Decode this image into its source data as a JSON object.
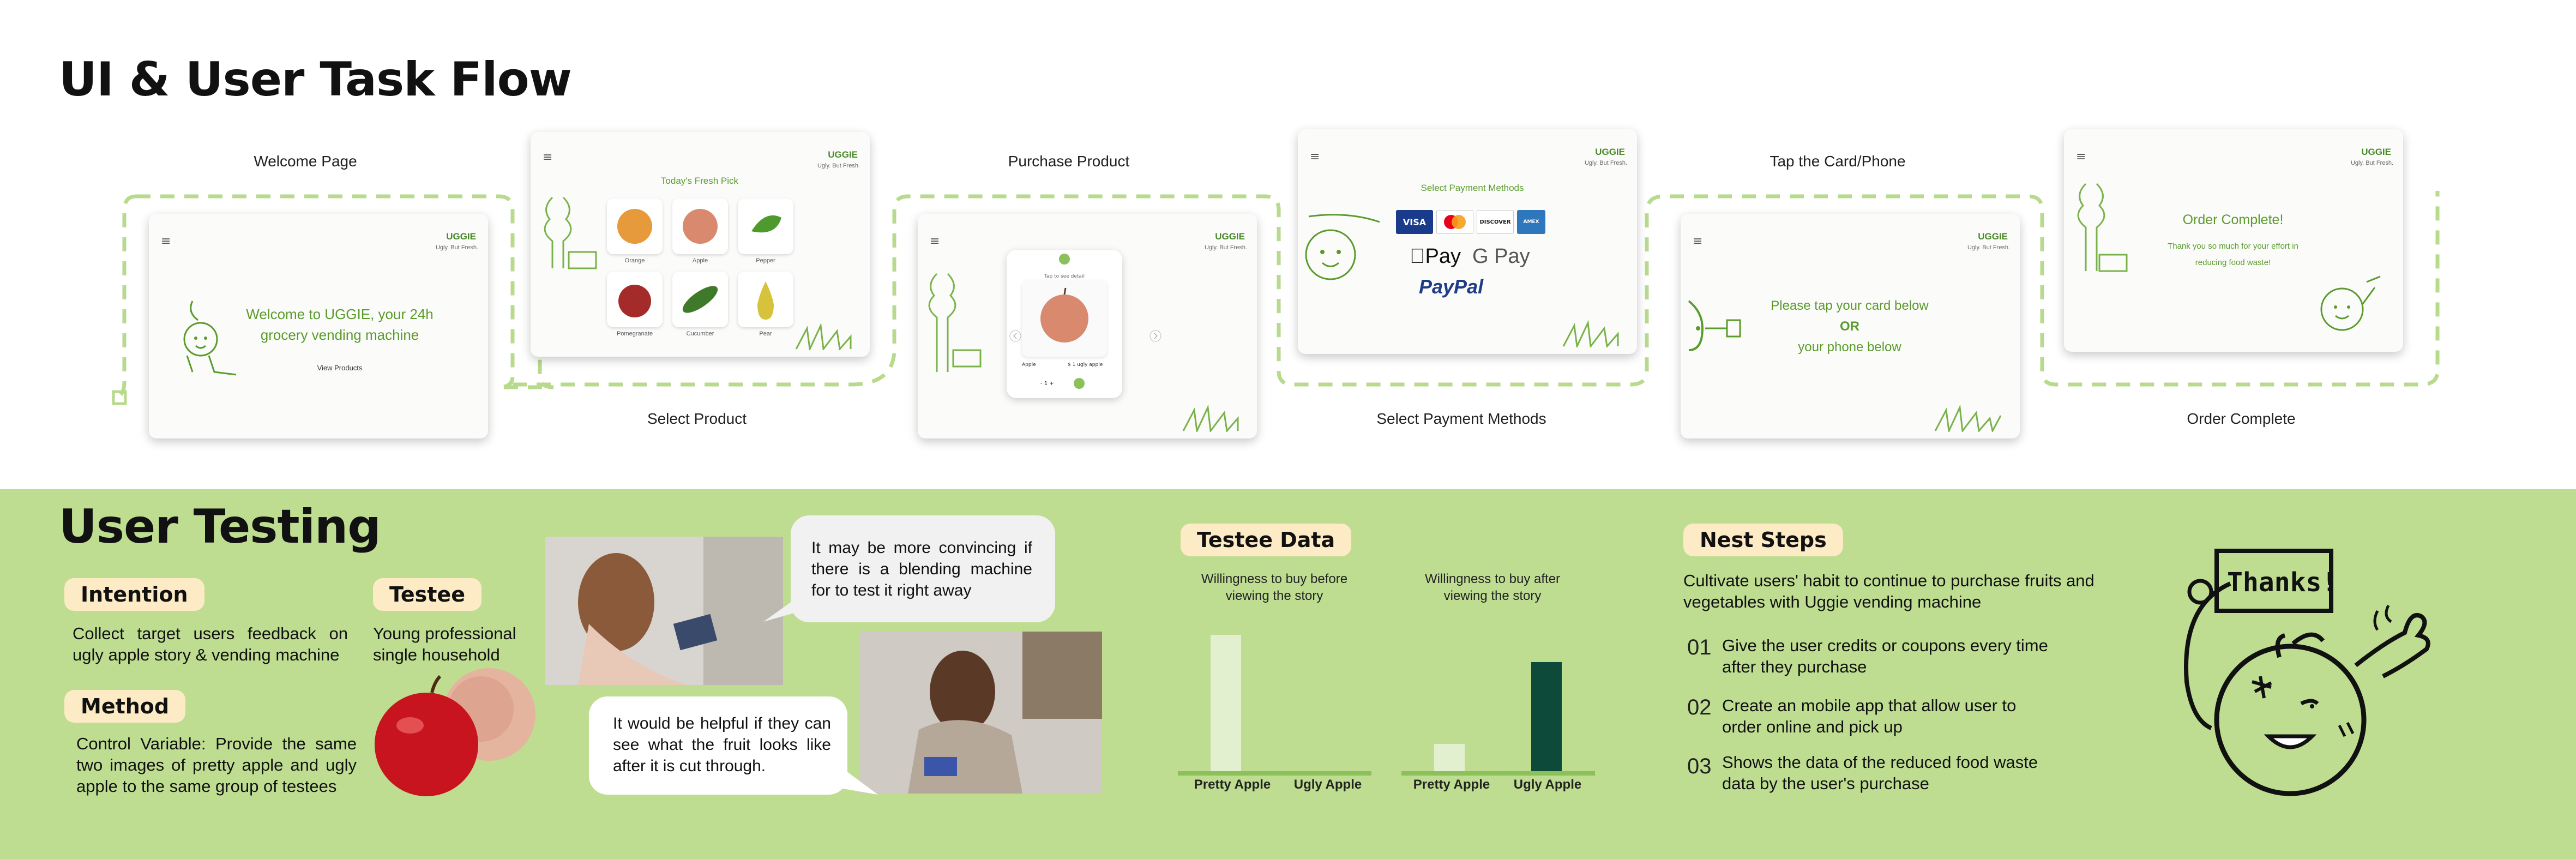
{
  "flow": {
    "title": "UI & User Task Flow",
    "steps": [
      {
        "caption": "Welcome Page"
      },
      {
        "caption": "Select Product"
      },
      {
        "caption": "Purchase Product"
      },
      {
        "caption": "Select Payment Methods"
      },
      {
        "caption": "Tap the Card/Phone"
      },
      {
        "caption": "Order Complete"
      }
    ],
    "brand": "UGGIE",
    "tagline": "Ugly. But Fresh.",
    "menu_icon": "≡",
    "welcome": {
      "line1": "Welcome to UGGIE, your 24h",
      "line2": "grocery vending machine",
      "button": "View Products"
    },
    "select": {
      "heading": "Today's Fresh Pick",
      "products": [
        "Orange",
        "Apple",
        "Pepper",
        "Pomegranate",
        "Cucumber",
        "Pear"
      ]
    },
    "purchase": {
      "card_title": "Tap to see detail",
      "item_name": "Apple",
      "item_price": "$ 1 ugly apple",
      "quantity": "- 1 +"
    },
    "payment": {
      "heading": "Select Payment Methods",
      "cards": [
        "VISA",
        "MasterCard",
        "DISCOVER",
        "AMEX"
      ],
      "apple_pay": "Pay",
      "google_pay": "G Pay",
      "paypal": "PayPal"
    },
    "tap": {
      "line1": "Please tap your card below",
      "or": "OR",
      "line2": "your phone below"
    },
    "complete": {
      "title": "Order Complete!",
      "line1": "Thank you so much for your effort in",
      "line2": "reducing food waste!"
    }
  },
  "testing": {
    "title": "User Testing",
    "intention": {
      "label": "Intention",
      "text": "Collect target users feedback on ugly apple story & vending machine"
    },
    "testee": {
      "label": "Testee",
      "line1": "Young professional",
      "line2": "single household"
    },
    "method": {
      "label": "Method",
      "text": "Control Variable: Provide the same two images of pretty apple and ugly apple to the same group of testees"
    },
    "quotes": [
      "It may be more convincing if there is a blending machine for to test it right away",
      "It would be helpful if they can see what the fruit looks like after it is cut through."
    ],
    "testee_data": {
      "label": "Testee Data"
    },
    "next_steps": {
      "label": "Nest Steps",
      "intro": "Cultivate users' habit to continue to purchase fruits and vegetables with Uggie vending machine",
      "items": [
        {
          "num": "01",
          "text": "Give the user credits or coupons every time after they purchase"
        },
        {
          "num": "02",
          "text": "Create an mobile app that allow user to order online and pick up"
        },
        {
          "num": "03",
          "text": "Shows the data of the reduced food waste data by the user's purchase"
        }
      ]
    },
    "thanks_sign": "Thanks!"
  },
  "colors": {
    "bottom_bg": "#bedd91",
    "pill_bg": "#fdebc6",
    "brand_green": "#5a9b2c",
    "dash_green": "#b7da8c",
    "bar_light": "#e3f0d0",
    "bar_dark": "#0d4a3a",
    "axis_green": "#8cc05a"
  },
  "chart_data": [
    {
      "type": "bar",
      "title": "Willingness to buy before viewing the story",
      "categories": [
        "Pretty Apple",
        "Ugly Apple"
      ],
      "values": [
        10,
        0
      ]
    },
    {
      "type": "bar",
      "title": "Willingness to buy after viewing the story",
      "categories": [
        "Pretty Apple",
        "Ugly Apple"
      ],
      "values": [
        2,
        8
      ]
    }
  ]
}
